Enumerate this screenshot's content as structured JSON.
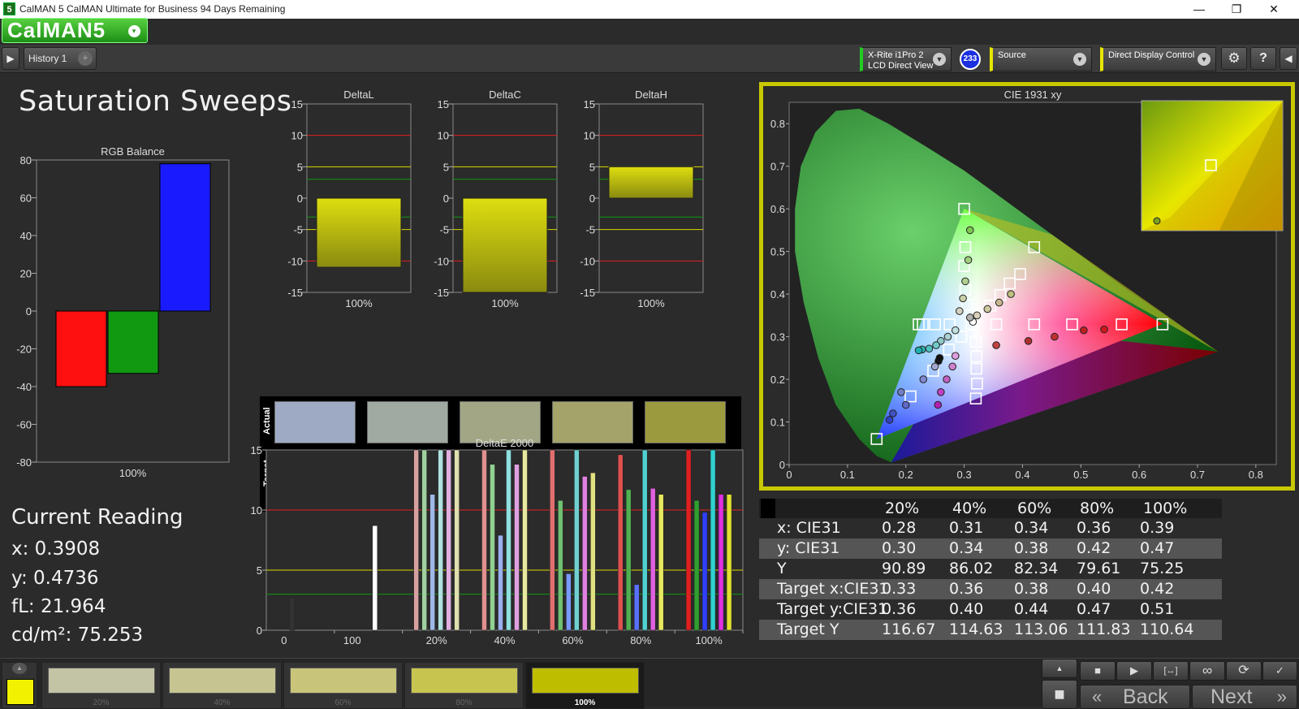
{
  "window": {
    "title": "CalMAN 5 CalMAN Ultimate for Business 94 Days Remaining",
    "minimize_glyph": "—",
    "restore_glyph": "❐",
    "close_glyph": "✕",
    "app_icon_text": "5"
  },
  "logo": {
    "text": "CalMAN5",
    "dropdown_glyph": "▾"
  },
  "toolbar": {
    "nav_glyph": "▶",
    "history_tab": "History 1",
    "add_tab_glyph": "+",
    "meter": {
      "line1": "X-Rite i1Pro 2",
      "line2": "LCD Direct View",
      "badge": "233"
    },
    "source": {
      "label": "Source"
    },
    "display": {
      "label": "Direct Display Control"
    },
    "settings_glyph": "⚙",
    "help_glyph": "?",
    "collapse_glyph": "◀"
  },
  "page": {
    "title": "Saturation Sweeps"
  },
  "rgb_balance": {
    "title": "RGB Balance",
    "xlabel": "100%",
    "ylim": [
      -80,
      80
    ],
    "yticks": [
      "80",
      "60",
      "40",
      "20",
      "0",
      "-20",
      "-40",
      "-60",
      "-80"
    ],
    "bars": [
      {
        "name": "Red",
        "value": -40,
        "color": "#ff1010"
      },
      {
        "name": "Green",
        "value": -33,
        "color": "#119911"
      },
      {
        "name": "Blue",
        "value": 78,
        "color": "#1a1aff"
      }
    ]
  },
  "delta_charts": [
    {
      "title": "DeltaL",
      "xlabel": "100%",
      "value": -11
    },
    {
      "title": "DeltaC",
      "xlabel": "100%",
      "value": -15
    },
    {
      "title": "DeltaH",
      "xlabel": "100%",
      "value": 5
    }
  ],
  "delta_yticks": [
    "15",
    "10",
    "5",
    "0",
    "-5",
    "-10",
    "-15"
  ],
  "swatches": {
    "actual_label": "Actual",
    "target_label": "Target",
    "levels": [
      {
        "label": "20%",
        "actual": "#9eaac4",
        "target": "#c3c3a6"
      },
      {
        "label": "40%",
        "actual": "#a1a9a3",
        "target": "#c6c591"
      },
      {
        "label": "60%",
        "actual": "#a2a685",
        "target": "#c8c47a"
      },
      {
        "label": "80%",
        "actual": "#a3a36a",
        "target": "#c7c44f"
      },
      {
        "label": "100%",
        "actual": "#9c9a3f",
        "target": "#bfbd00"
      }
    ]
  },
  "deltaE": {
    "title": "DeltaE 2000",
    "yticks": [
      "15",
      "10",
      "5",
      "0"
    ],
    "xticks": [
      "0",
      "100",
      "20%",
      "40%",
      "60%",
      "80%",
      "100%"
    ],
    "ylim": [
      0,
      15
    ],
    "groups": [
      {
        "bars": [
          {
            "value": 2.7,
            "color": "#333333"
          }
        ]
      },
      {
        "bars": [
          {
            "value": 8.7,
            "color": "#ffffff"
          }
        ]
      },
      {
        "bars": [
          {
            "value": 15,
            "color": "#d7a0a0"
          },
          {
            "value": 15,
            "color": "#a0d0a0"
          },
          {
            "value": 11.3,
            "color": "#a0b8e8"
          },
          {
            "value": 15,
            "color": "#b0e0e0"
          },
          {
            "value": 15,
            "color": "#e0b0e0"
          },
          {
            "value": 15,
            "color": "#e0e0b0"
          }
        ]
      },
      {
        "bars": [
          {
            "value": 15,
            "color": "#e09090"
          },
          {
            "value": 13.8,
            "color": "#90d090"
          },
          {
            "value": 7.9,
            "color": "#9ab0f0"
          },
          {
            "value": 15,
            "color": "#90e0e0"
          },
          {
            "value": 13.8,
            "color": "#e0a0e0"
          },
          {
            "value": 15,
            "color": "#e8e8a0"
          }
        ]
      },
      {
        "bars": [
          {
            "value": 15,
            "color": "#e07070"
          },
          {
            "value": 10.8,
            "color": "#70c070"
          },
          {
            "value": 4.7,
            "color": "#7a9aff"
          },
          {
            "value": 15,
            "color": "#70d0d0"
          },
          {
            "value": 12.8,
            "color": "#e080e0"
          },
          {
            "value": 13.1,
            "color": "#e0e080"
          }
        ]
      },
      {
        "bars": [
          {
            "value": 14.6,
            "color": "#e05050"
          },
          {
            "value": 11.7,
            "color": "#50b050"
          },
          {
            "value": 3.8,
            "color": "#5a70ff"
          },
          {
            "value": 15,
            "color": "#50d0d0"
          },
          {
            "value": 11.8,
            "color": "#e060e0"
          },
          {
            "value": 11.3,
            "color": "#e8e860"
          }
        ]
      },
      {
        "bars": [
          {
            "value": 15,
            "color": "#e02020"
          },
          {
            "value": 10.8,
            "color": "#30a030"
          },
          {
            "value": 9.8,
            "color": "#3040ff"
          },
          {
            "value": 15,
            "color": "#30d0d0"
          },
          {
            "value": 11.3,
            "color": "#e030e0"
          },
          {
            "value": 11.3,
            "color": "#e0e030"
          }
        ]
      }
    ]
  },
  "current_reading": {
    "title": "Current Reading",
    "x": "x: 0.3908",
    "y": "y: 0.4736",
    "fl": "fL: 21.964",
    "cdm2": "cd/m²: 75.253"
  },
  "cie": {
    "title": "CIE 1931 xy",
    "xticks": [
      "0",
      "0.1",
      "0.2",
      "0.3",
      "0.4",
      "0.5",
      "0.6",
      "0.7",
      "0.8"
    ],
    "yticks": [
      "0.8",
      "0.7",
      "0.6",
      "0.5",
      "0.4",
      "0.3",
      "0.2",
      "0.1",
      "0"
    ],
    "gamut": {
      "red": [
        0.64,
        0.33
      ],
      "green": [
        0.3,
        0.6
      ],
      "blue": [
        0.15,
        0.06
      ],
      "white": [
        0.3127,
        0.329
      ]
    },
    "targets": [
      [
        0.3127,
        0.329
      ],
      [
        0.275,
        0.329
      ],
      [
        0.25,
        0.329
      ],
      [
        0.229,
        0.329
      ],
      [
        0.222,
        0.329
      ],
      [
        0.355,
        0.329
      ],
      [
        0.42,
        0.329
      ],
      [
        0.485,
        0.329
      ],
      [
        0.57,
        0.329
      ],
      [
        0.64,
        0.329
      ],
      [
        0.305,
        0.375
      ],
      [
        0.302,
        0.41
      ],
      [
        0.3,
        0.466
      ],
      [
        0.302,
        0.51
      ],
      [
        0.3,
        0.6
      ],
      [
        0.345,
        0.373
      ],
      [
        0.362,
        0.398
      ],
      [
        0.378,
        0.425
      ],
      [
        0.396,
        0.447
      ],
      [
        0.42,
        0.51
      ],
      [
        0.32,
        0.288
      ],
      [
        0.321,
        0.254
      ],
      [
        0.321,
        0.225
      ],
      [
        0.322,
        0.19
      ],
      [
        0.32,
        0.155
      ],
      [
        0.295,
        0.3
      ],
      [
        0.274,
        0.27
      ],
      [
        0.247,
        0.22
      ],
      [
        0.208,
        0.16
      ],
      [
        0.15,
        0.06
      ]
    ],
    "measured": [
      {
        "x": 0.315,
        "y": 0.335,
        "c": "#ffffff"
      },
      {
        "x": 0.31,
        "y": 0.55,
        "c": "#7ec850"
      },
      {
        "x": 0.307,
        "y": 0.48,
        "c": "#9fd080"
      },
      {
        "x": 0.302,
        "y": 0.43,
        "c": "#b0d090"
      },
      {
        "x": 0.298,
        "y": 0.39,
        "c": "#c8d0a8"
      },
      {
        "x": 0.292,
        "y": 0.36,
        "c": "#d0d0c0"
      },
      {
        "x": 0.36,
        "y": 0.38,
        "c": "#c8b890"
      },
      {
        "x": 0.34,
        "y": 0.365,
        "c": "#d0c8a0"
      },
      {
        "x": 0.322,
        "y": 0.35,
        "c": "#d8d0b8"
      },
      {
        "x": 0.31,
        "y": 0.345,
        "c": "#b0b0b0"
      },
      {
        "x": 0.38,
        "y": 0.4,
        "c": "#c0c080"
      },
      {
        "x": 0.355,
        "y": 0.28,
        "c": "#c04040"
      },
      {
        "x": 0.41,
        "y": 0.29,
        "c": "#b03030"
      },
      {
        "x": 0.455,
        "y": 0.3,
        "c": "#c03030"
      },
      {
        "x": 0.505,
        "y": 0.315,
        "c": "#c02020"
      },
      {
        "x": 0.54,
        "y": 0.317,
        "c": "#d01818"
      },
      {
        "x": 0.285,
        "y": 0.315,
        "c": "#c0e0e0"
      },
      {
        "x": 0.272,
        "y": 0.3,
        "c": "#a8d0d0"
      },
      {
        "x": 0.26,
        "y": 0.29,
        "c": "#90c8c8"
      },
      {
        "x": 0.252,
        "y": 0.28,
        "c": "#70c8c8"
      },
      {
        "x": 0.24,
        "y": 0.272,
        "c": "#50c0c0"
      },
      {
        "x": 0.228,
        "y": 0.27,
        "c": "#30b0b0"
      },
      {
        "x": 0.222,
        "y": 0.268,
        "c": "#20b0b0"
      },
      {
        "x": 0.256,
        "y": 0.243,
        "c": "#111111"
      },
      {
        "x": 0.258,
        "y": 0.25,
        "c": "#101010"
      },
      {
        "x": 0.25,
        "y": 0.23,
        "c": "#a0a8d0"
      },
      {
        "x": 0.23,
        "y": 0.2,
        "c": "#8088d0"
      },
      {
        "x": 0.2,
        "y": 0.14,
        "c": "#6068c8"
      },
      {
        "x": 0.178,
        "y": 0.12,
        "c": "#4050c0"
      },
      {
        "x": 0.172,
        "y": 0.105,
        "c": "#3040c0"
      },
      {
        "x": 0.285,
        "y": 0.255,
        "c": "#e0a0e0"
      },
      {
        "x": 0.28,
        "y": 0.23,
        "c": "#d080d0"
      },
      {
        "x": 0.27,
        "y": 0.2,
        "c": "#c060c0"
      },
      {
        "x": 0.26,
        "y": 0.17,
        "c": "#c040c0"
      },
      {
        "x": 0.255,
        "y": 0.14,
        "c": "#b020b0"
      },
      {
        "x": 0.192,
        "y": 0.17,
        "c": "#7080c0"
      }
    ]
  },
  "table": {
    "headers": [
      "",
      "20%",
      "40%",
      "60%",
      "80%",
      "100%"
    ],
    "rows": [
      {
        "label": "x: CIE31",
        "values": [
          "0.28",
          "0.31",
          "0.34",
          "0.36",
          "0.39"
        ]
      },
      {
        "label": "y: CIE31",
        "values": [
          "0.30",
          "0.34",
          "0.38",
          "0.42",
          "0.47"
        ]
      },
      {
        "label": "Y",
        "values": [
          "90.89",
          "86.02",
          "82.34",
          "79.61",
          "75.25"
        ]
      },
      {
        "label": "Target x:CIE31",
        "values": [
          "0.33",
          "0.36",
          "0.38",
          "0.40",
          "0.42"
        ]
      },
      {
        "label": "Target y:CIE31",
        "values": [
          "0.36",
          "0.40",
          "0.44",
          "0.47",
          "0.51"
        ]
      },
      {
        "label": "Target Y",
        "values": [
          "116.67",
          "114.63",
          "113.06",
          "111.83",
          "110.64"
        ]
      }
    ]
  },
  "bottom": {
    "current_color": "#f2f200",
    "up_glyph": "▲",
    "swatches": [
      {
        "label": "20%",
        "color": "#c3c3a6"
      },
      {
        "label": "40%",
        "color": "#c6c591"
      },
      {
        "label": "60%",
        "color": "#c8c47a"
      },
      {
        "label": "80%",
        "color": "#c7c44f"
      },
      {
        "label": "100%",
        "color": "#bfbd00"
      }
    ],
    "controls": {
      "stop": "■",
      "play": "▶",
      "fit": "[↔]",
      "loop": "∞",
      "refresh": "⟳",
      "check": "✓",
      "stop_big": "■"
    },
    "back": "Back",
    "next": "Next",
    "back_glyph": "«",
    "next_glyph": "»"
  }
}
